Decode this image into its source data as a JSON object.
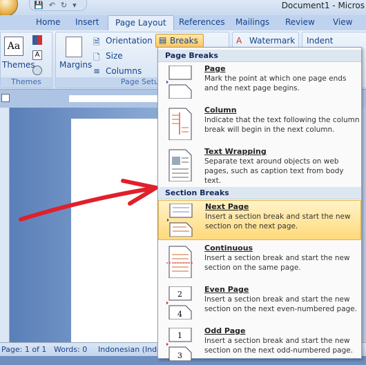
{
  "window": {
    "title": "Document1 - Micros"
  },
  "tabs": [
    "Home",
    "Insert",
    "Page Layout",
    "References",
    "Mailings",
    "Review",
    "View"
  ],
  "active_tab": "Page Layout",
  "ribbon": {
    "themes_group": {
      "label": "Themes",
      "themes_button": "Themes"
    },
    "page_setup_group": {
      "label": "Page Setup",
      "margins": "Margins",
      "orientation": "Orientation",
      "size": "Size",
      "columns": "Columns",
      "breaks": "Breaks"
    },
    "watermark": "Watermark",
    "indent": "Indent"
  },
  "breaks_menu": {
    "page_breaks_header": "Page Breaks",
    "section_breaks_header": "Section Breaks",
    "items": [
      {
        "title": "Page",
        "desc": "Mark the point at which one page ends and the next page begins.",
        "icon": "page-break-icon"
      },
      {
        "title": "Column",
        "desc": "Indicate that the text following the column break will begin in the next column.",
        "icon": "column-break-icon"
      },
      {
        "title": "Text Wrapping",
        "desc": "Separate text around objects on web pages, such as caption text from body text.",
        "icon": "text-wrapping-icon"
      },
      {
        "title": "Next Page",
        "desc": "Insert a section break and start the new section on the next page.",
        "icon": "next-page-icon",
        "highlighted": true
      },
      {
        "title": "Continuous",
        "desc": "Insert a section break and start the new section on the same page.",
        "icon": "continuous-icon"
      },
      {
        "title": "Even Page",
        "desc": "Insert a section break and start the new section on the next even-numbered page.",
        "icon": "even-page-icon"
      },
      {
        "title": "Odd Page",
        "desc": "Insert a section break and start the new section on the next odd-numbered page.",
        "icon": "odd-page-icon"
      }
    ]
  },
  "status": {
    "page": "Page: 1 of 1",
    "words": "Words: 0",
    "language": "Indonesian (Indo"
  },
  "colors": {
    "accent": "#15428b",
    "highlight": "#ffd97a",
    "arrow": "#e0202a"
  }
}
